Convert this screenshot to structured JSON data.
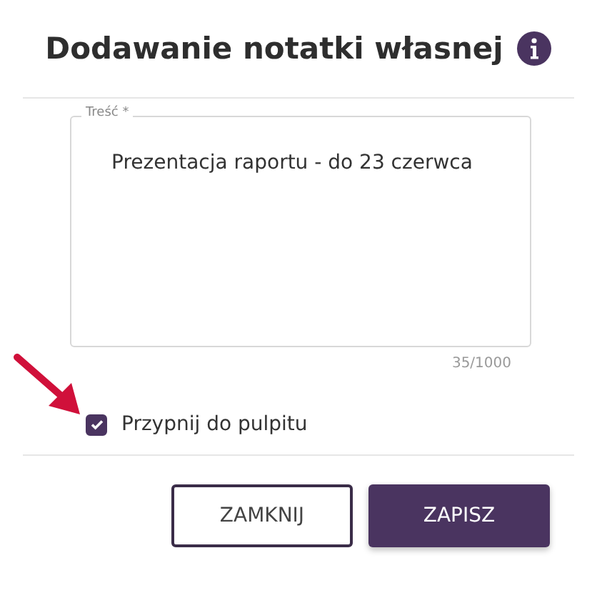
{
  "dialog": {
    "title": "Dodawanie notatki własnej",
    "note_field": {
      "label": "Treść *",
      "value": "Prezentacja raportu - do 23 czerwca",
      "counter": "35/1000"
    },
    "pin_checkbox": {
      "label": "Przypnij do pulpitu",
      "checked": true
    },
    "buttons": [
      {
        "label": "ZAMKNIJ",
        "kind": "secondary"
      },
      {
        "label": "ZAPISZ",
        "kind": "primary"
      }
    ]
  }
}
